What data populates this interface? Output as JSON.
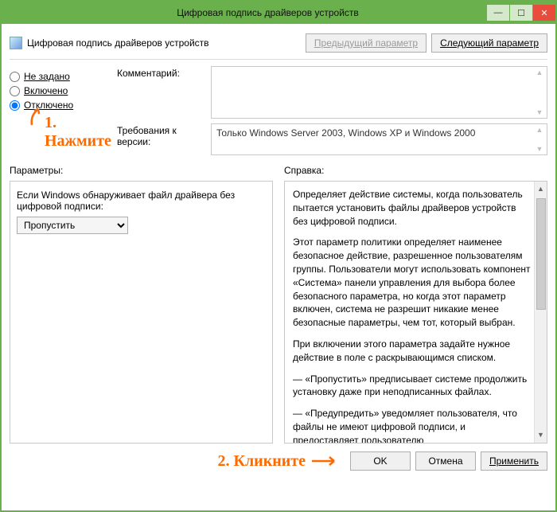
{
  "window": {
    "title": "Цифровая подпись драйверов устройств",
    "header": "Цифровая подпись драйверов устройств",
    "nav_prev": "Предыдущий параметр",
    "nav_next": "Следующий параметр"
  },
  "state": {
    "not_configured": "Не задано",
    "enabled": "Включено",
    "disabled": "Отключено",
    "selected": "disabled"
  },
  "fields": {
    "comment_label": "Комментарий:",
    "requirements_label": "Требования к версии:",
    "requirements_value": "Только Windows Server 2003, Windows XP и Windows 2000"
  },
  "annotations": {
    "step1": "1. Нажмите",
    "step2": "2. Кликните"
  },
  "panels": {
    "params_title": "Параметры:",
    "help_title": "Справка:"
  },
  "params": {
    "prompt": "Если Windows обнаруживает файл драйвера без цифровой подписи:",
    "dropdown_value": "Пропустить"
  },
  "help": {
    "p1": "Определяет действие системы, когда пользователь пытается установить файлы драйверов устройств без цифровой подписи.",
    "p2": "Этот параметр политики определяет наименее безопасное действие, разрешенное пользователям группы. Пользователи могут использовать компонент «Система» панели управления для выбора более безопасного параметра, но когда этот параметр включен, система не разрешит никакие менее безопасные параметры, чем тот, который выбран.",
    "p3": "При включении этого параметра задайте нужное действие в поле с раскрывающимся списком.",
    "p4": "— «Пропустить» предписывает системе продолжить установку даже при неподписанных файлах.",
    "p5": "— «Предупредить» уведомляет пользователя, что файлы не имеют цифровой подписи, и предоставляет пользователю"
  },
  "buttons": {
    "ok": "OK",
    "cancel": "Отмена",
    "apply": "Применить"
  }
}
